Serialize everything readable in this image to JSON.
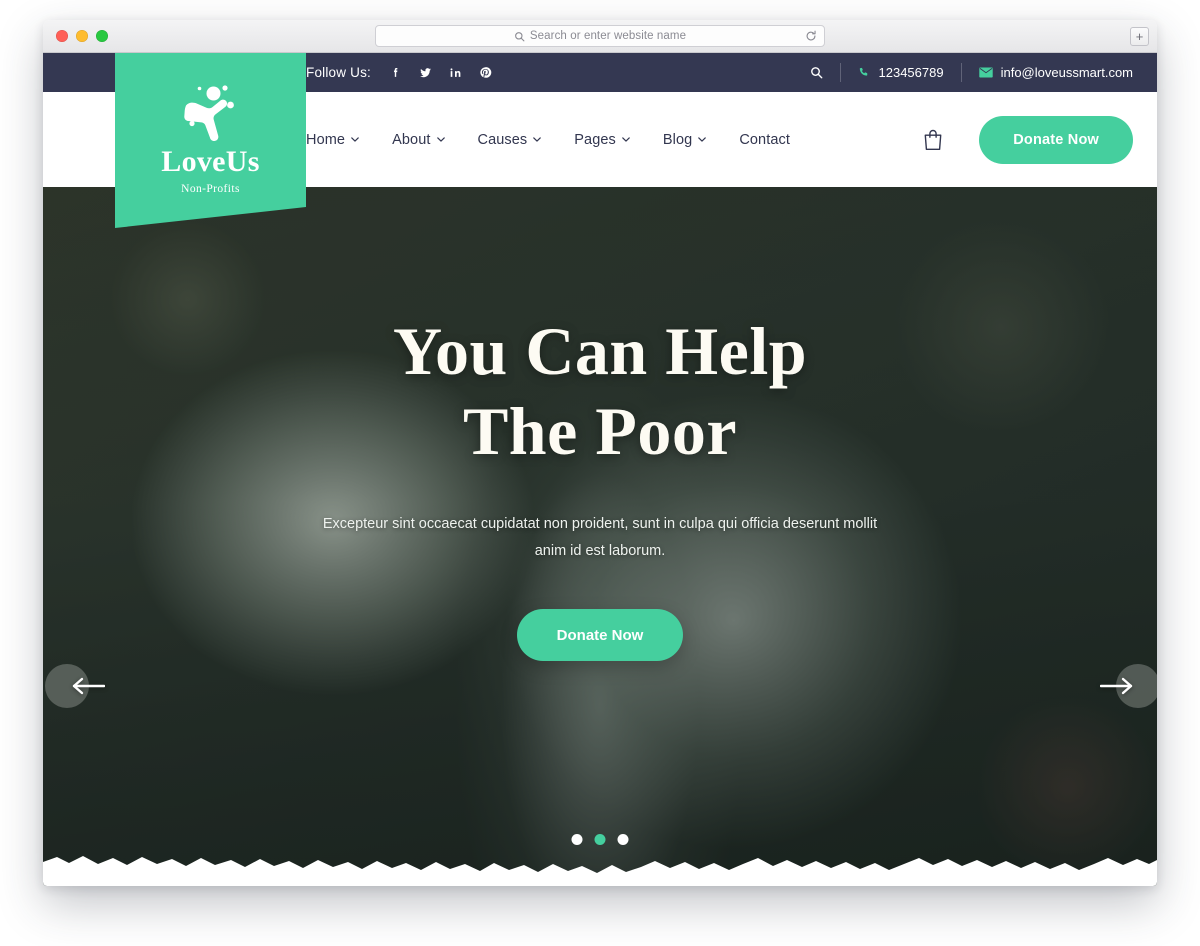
{
  "browser": {
    "address_placeholder": "Search or enter website name",
    "search_icon": "search-icon",
    "reload_icon": "reload-icon",
    "newtab_label": "+",
    "traffic_lights": [
      "close",
      "minimize",
      "zoom"
    ]
  },
  "topbar": {
    "follow_label": "Follow Us:",
    "socials": [
      {
        "name": "facebook-icon",
        "glyph": "f"
      },
      {
        "name": "twitter-icon",
        "glyph": "t"
      },
      {
        "name": "linkedin-icon",
        "glyph": "in"
      },
      {
        "name": "pinterest-icon",
        "glyph": "p"
      }
    ],
    "search_icon": "search-icon",
    "phone": "123456789",
    "email": "info@loveussmart.com"
  },
  "logo": {
    "word": "LoveUs",
    "tagline": "Non-Profits",
    "mark": "person-figure-icon"
  },
  "nav": {
    "items": [
      {
        "label": "Home",
        "has_dropdown": true
      },
      {
        "label": "About",
        "has_dropdown": true
      },
      {
        "label": "Causes",
        "has_dropdown": true
      },
      {
        "label": "Pages",
        "has_dropdown": true
      },
      {
        "label": "Blog",
        "has_dropdown": true
      },
      {
        "label": "Contact",
        "has_dropdown": false
      }
    ],
    "cart_icon": "shopping-bag-icon",
    "donate_label": "Donate Now"
  },
  "hero": {
    "title_line1": "You Can Help",
    "title_line2": "The Poor",
    "subtitle": "Excepteur sint occaecat cupidatat non proident, sunt in culpa qui officia deserunt mollit anim id est laborum.",
    "cta_label": "Donate Now",
    "prev_icon": "arrow-left-icon",
    "next_icon": "arrow-right-icon",
    "slides": 3,
    "active_slide": 2
  },
  "colors": {
    "accent": "#45cf9e",
    "topbar": "#343852",
    "nav_text": "#32364f",
    "hero_text": "#fdfbf3"
  }
}
